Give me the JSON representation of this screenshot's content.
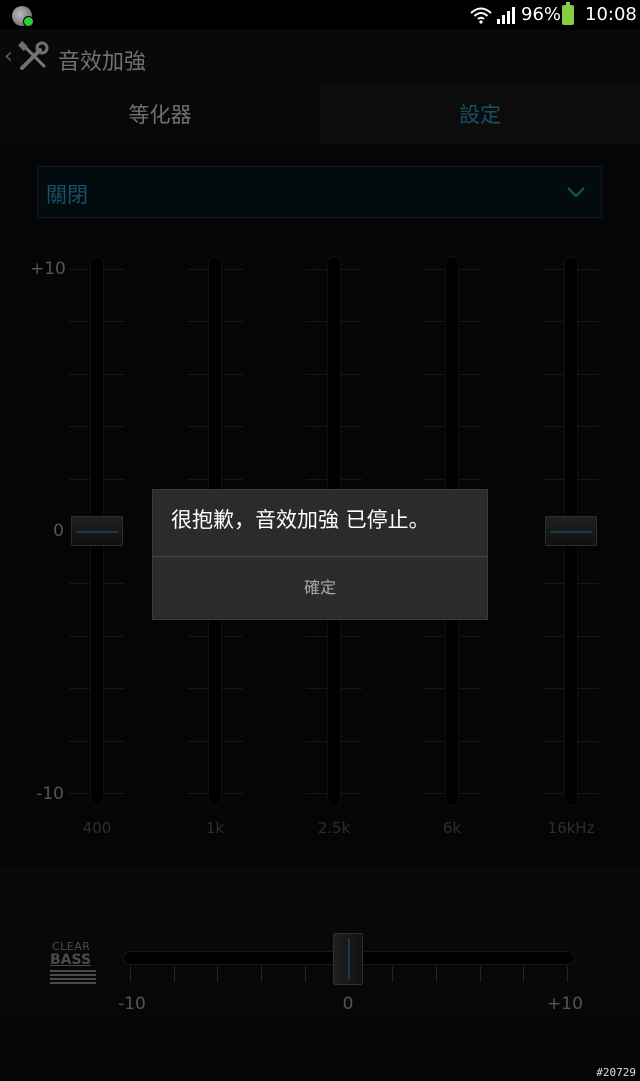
{
  "status_bar": {
    "battery_percent": "96%",
    "time": "10:08",
    "icons": [
      "notification-icon",
      "wifi-icon",
      "signal-icon",
      "battery-icon"
    ]
  },
  "action_bar": {
    "title": "音效加強",
    "icons": [
      "back-chevron-icon",
      "tools-icon"
    ]
  },
  "tabs": [
    {
      "label": "等化器"
    },
    {
      "label": "設定"
    }
  ],
  "preset": {
    "value": "關閉",
    "icon": "chevron-down-icon"
  },
  "equalizer": {
    "scale_labels": [
      "+10",
      "0",
      "-10"
    ],
    "bands": [
      {
        "label": "400"
      },
      {
        "label": "1k"
      },
      {
        "label": "2.5k"
      },
      {
        "label": "6k"
      },
      {
        "label": "16kHz"
      }
    ]
  },
  "clear_bass": {
    "logo_top": "CLEAR",
    "logo_bottom": "BASS",
    "labels": [
      "-10",
      "0",
      "+10"
    ]
  },
  "dialog": {
    "message": "很抱歉，音效加強 已停止。",
    "ok_label": "確定"
  },
  "watermark": "#20729"
}
